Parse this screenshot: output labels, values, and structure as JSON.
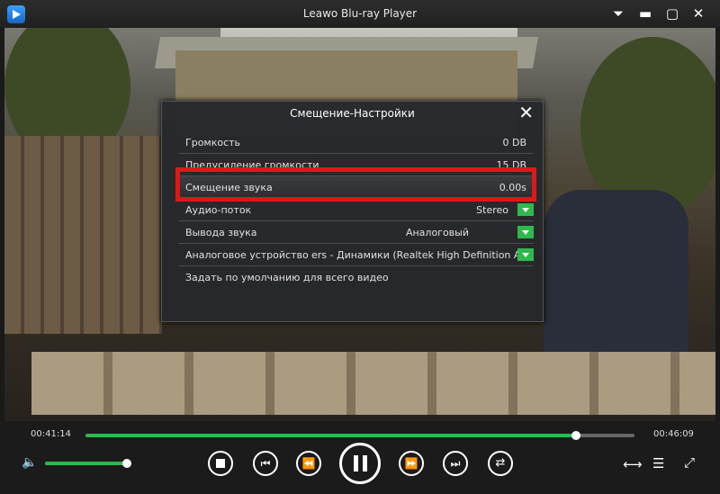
{
  "window": {
    "title": "Leawo Blu-ray Player"
  },
  "icons": [
    "app-logo-icon",
    "menu-dropdown-icon",
    "minimize-icon",
    "maximize-icon",
    "close-icon",
    "volume-icon",
    "stop-icon",
    "previous-chapter-icon",
    "rewind-icon",
    "pause-icon",
    "fast-forward-icon",
    "next-chapter-icon",
    "playlist-icon",
    "share-icon",
    "menu-list-icon",
    "fullscreen-icon"
  ],
  "dialog": {
    "title": "Смещение-Настройки",
    "rows": [
      {
        "label": "Громкость",
        "value": "0 DB"
      },
      {
        "label": "Предусиление громкости",
        "value": "15 DB"
      },
      {
        "label": "Смещение звука",
        "value": "0.00s"
      },
      {
        "label": "Аудио-поток",
        "value": "Stereo"
      },
      {
        "label": "Вывода звука",
        "value": "Аналоговый"
      },
      {
        "label": "Аналоговое устройство",
        "value": "ers - Динамики (Realtek High Definition A"
      },
      {
        "label": "Задать по умолчанию для всего видео",
        "value": ""
      }
    ]
  },
  "player": {
    "elapsed": "00:41:14",
    "duration": "00:46:09",
    "progress_fraction": 0.893,
    "volume_fraction": 0.96
  },
  "colors": {
    "accent": "#2eb84e",
    "highlight": "#e0161b",
    "background": "#1b1b1b"
  }
}
